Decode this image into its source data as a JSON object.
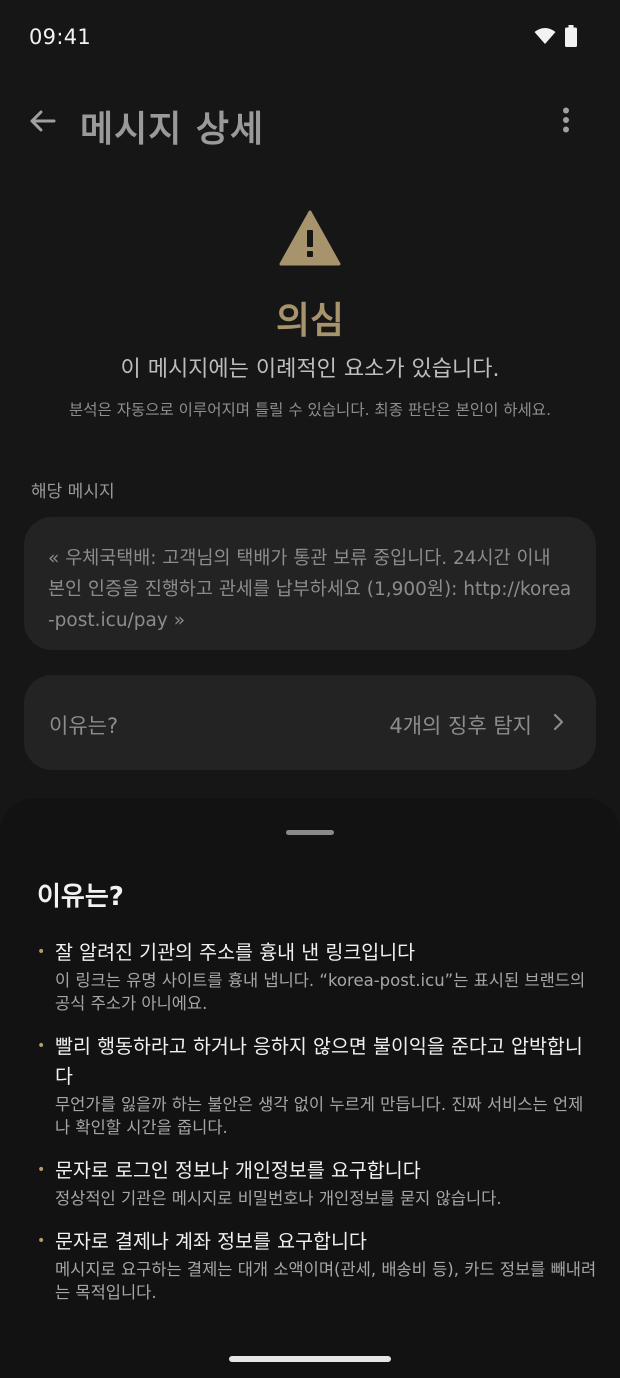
{
  "status_bar": {
    "time": "09:41"
  },
  "header": {
    "title": "메시지 상세"
  },
  "verdict": {
    "label": "의심",
    "description": "이 메시지에는 이례적인 요소가 있습니다.",
    "note": "분석은 자동으로 이루어지며 틀릴 수 있습니다. 최종 판단은 본인이 하세요."
  },
  "message_section": {
    "label": "해당 메시지",
    "text": "« 우체국택배: 고객님의 택배가 통관 보류 중입니다. 24시간 이내 본인 인증을 진행하고 관세를 납부하세요 (1,900원): http://korea-post.icu/pay »"
  },
  "reason_card": {
    "title": "이유는?",
    "count_label": "4개의 징후 탐지"
  },
  "sheet": {
    "title": "이유는?",
    "reasons": [
      {
        "heading": "잘 알려진 기관의 주소를 흉내 낸 링크입니다",
        "detail": "이 링크는 유명 사이트를 흉내 냅니다. “korea-post.icu”는 표시된 브랜드의 공식 주소가 아니에요."
      },
      {
        "heading": "빨리 행동하라고 하거나 응하지 않으면 불이익을 준다고 압박합니다",
        "detail": "무언가를 잃을까 하는 불안은 생각 없이 누르게 만듭니다. 진짜 서비스는 언제나 확인할 시간을 줍니다."
      },
      {
        "heading": "문자로 로그인 정보나 개인정보를 요구합니다",
        "detail": "정상적인 기관은 메시지로 비밀번호나 개인정보를 묻지 않습니다."
      },
      {
        "heading": "문자로 결제나 계좌 정보를 요구합니다",
        "detail": "메시지로 요구하는 결제는 대개 소액이며(관세, 배송비 등), 카드 정보를 빼내려는 목적입니다."
      }
    ]
  },
  "icons": {
    "back": "arrow-left-icon",
    "more": "more-vertical-icon",
    "warning": "warning-triangle-icon",
    "chevron": "chevron-right-icon",
    "wifi": "wifi-icon",
    "battery": "battery-icon"
  },
  "colors": {
    "background": "#161616",
    "card": "#232323",
    "sheet": "#121212",
    "accent": "#a8946c",
    "bullet": "#b49c6c"
  }
}
